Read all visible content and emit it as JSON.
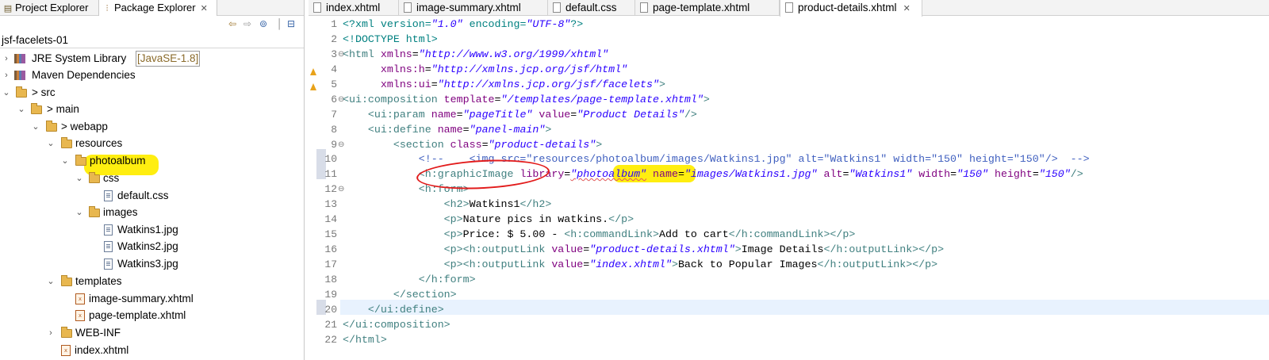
{
  "left_panel": {
    "tabs": [
      {
        "label": "Project Explorer",
        "icon": "project-explorer-icon"
      },
      {
        "label": "Package Explorer",
        "icon": "package-explorer-icon",
        "close": "✕"
      }
    ],
    "project": "jsf-facelets-01",
    "tree": [
      {
        "label": "JRE System Library",
        "suffix": "[JavaSE-1.8]"
      },
      {
        "label": "Maven Dependencies"
      },
      {
        "label": "> src"
      },
      {
        "label": "> main"
      },
      {
        "label": "> webapp"
      },
      {
        "label": "resources"
      },
      {
        "label": "photoalbum"
      },
      {
        "label": "css"
      },
      {
        "label": "default.css"
      },
      {
        "label": "images"
      },
      {
        "label": "Watkins1.jpg"
      },
      {
        "label": "Watkins2.jpg"
      },
      {
        "label": "Watkins3.jpg"
      },
      {
        "label": "templates"
      },
      {
        "label": "image-summary.xhtml"
      },
      {
        "label": "page-template.xhtml"
      },
      {
        "label": "WEB-INF"
      },
      {
        "label": "index.xhtml"
      }
    ]
  },
  "editor": {
    "tabs": [
      {
        "label": "index.xhtml"
      },
      {
        "label": "image-summary.xhtml"
      },
      {
        "label": "default.css"
      },
      {
        "label": "page-template.xhtml"
      },
      {
        "label": "product-details.xhtml",
        "close": "✕"
      }
    ],
    "line_numbers": [
      "1",
      "2",
      "3",
      "4",
      "5",
      "6",
      "7",
      "8",
      "9",
      "10",
      "11",
      "12",
      "13",
      "14",
      "15",
      "16",
      "17",
      "18",
      "19",
      "20",
      "21",
      "22"
    ],
    "code": {
      "l1_a": "<?xml version=",
      "l1_b": "\"1.0\"",
      "l1_c": " encoding=",
      "l1_d": "\"UTF-8\"",
      "l1_e": "?>",
      "l2": "<!DOCTYPE html>",
      "l3_a": "<html ",
      "l3_b": "xmlns",
      "l3_c": "=",
      "l3_d": "\"http://www.w3.org/1999/xhtml\"",
      "l4_a": "      xmlns:h",
      "l4_b": "=",
      "l4_c": "\"http://xmlns.jcp.org/jsf/html\"",
      "l5_a": "      xmlns:ui",
      "l5_b": "=",
      "l5_c": "\"http://xmlns.jcp.org/jsf/facelets\"",
      "l5_d": ">",
      "l6_a": "<ui:composition ",
      "l6_b": "template",
      "l6_c": "=",
      "l6_d": "\"/templates/page-template.xhtml\"",
      "l6_e": ">",
      "l7_a": "    <ui:param ",
      "l7_b": "name",
      "l7_c": "=",
      "l7_d": "\"pageTitle\"",
      "l7_e": " value",
      "l7_f": "=",
      "l7_g": "\"Product Details\"",
      "l7_h": "/>",
      "l8_a": "    <ui:define ",
      "l8_b": "name",
      "l8_c": "=",
      "l8_d": "\"panel-main\"",
      "l8_e": ">",
      "l9_a": "        <section ",
      "l9_b": "class",
      "l9_c": "=",
      "l9_d": "\"product-details\"",
      "l9_e": ">",
      "l10": "            <!--    <img src=\"resources/photoalbum/images/Watkins1.jpg\" alt=\"Watkins1\" width=\"150\" height=\"150\"/>  -->",
      "l11_a": "            <h:graphicImage ",
      "l11_b": "library",
      "l11_c": "=",
      "l11_d": "\"photoalbum\"",
      "l11_e": " name",
      "l11_f": "=",
      "l11_g": "\"images/Watkins1.jpg\"",
      "l11_h": " alt",
      "l11_i": "=",
      "l11_j": "\"Watkins1\"",
      "l11_k": " width",
      "l11_l": "=",
      "l11_m": "\"150\"",
      "l11_n": " height",
      "l11_o": "=",
      "l11_p": "\"150\"",
      "l11_q": "/>",
      "l12": "            <h:form>",
      "l13_a": "                <h2>",
      "l13_b": "Watkins1",
      "l13_c": "</h2>",
      "l14_a": "                <p>",
      "l14_b": "Nature pics in watkins.",
      "l14_c": "</p>",
      "l15_a": "                <p>",
      "l15_b": "Price: $ 5.00 - ",
      "l15_c": "<h:commandLink>",
      "l15_d": "Add to cart",
      "l15_e": "</h:commandLink></p>",
      "l16_a": "                <p><h:outputLink ",
      "l16_b": "value",
      "l16_c": "=",
      "l16_d": "\"product-details.xhtml\"",
      "l16_e": ">",
      "l16_f": "Image Details",
      "l16_g": "</h:outputLink></p>",
      "l17_a": "                <p><h:outputLink ",
      "l17_b": "value",
      "l17_c": "=",
      "l17_d": "\"index.xhtml\"",
      "l17_e": ">",
      "l17_f": "Back to Popular Images",
      "l17_g": "</h:outputLink></p>",
      "l18": "            </h:form>",
      "l19": "        </section>",
      "l20": "    </ui:define>",
      "l21": "</ui:composition>",
      "l22": "</html>"
    }
  },
  "colors": {
    "highlight": "#ffee10",
    "annotation": "#e21b1b",
    "tag": "#3f7f7f",
    "attribute": "#7f007f",
    "value": "#2a00ff"
  }
}
